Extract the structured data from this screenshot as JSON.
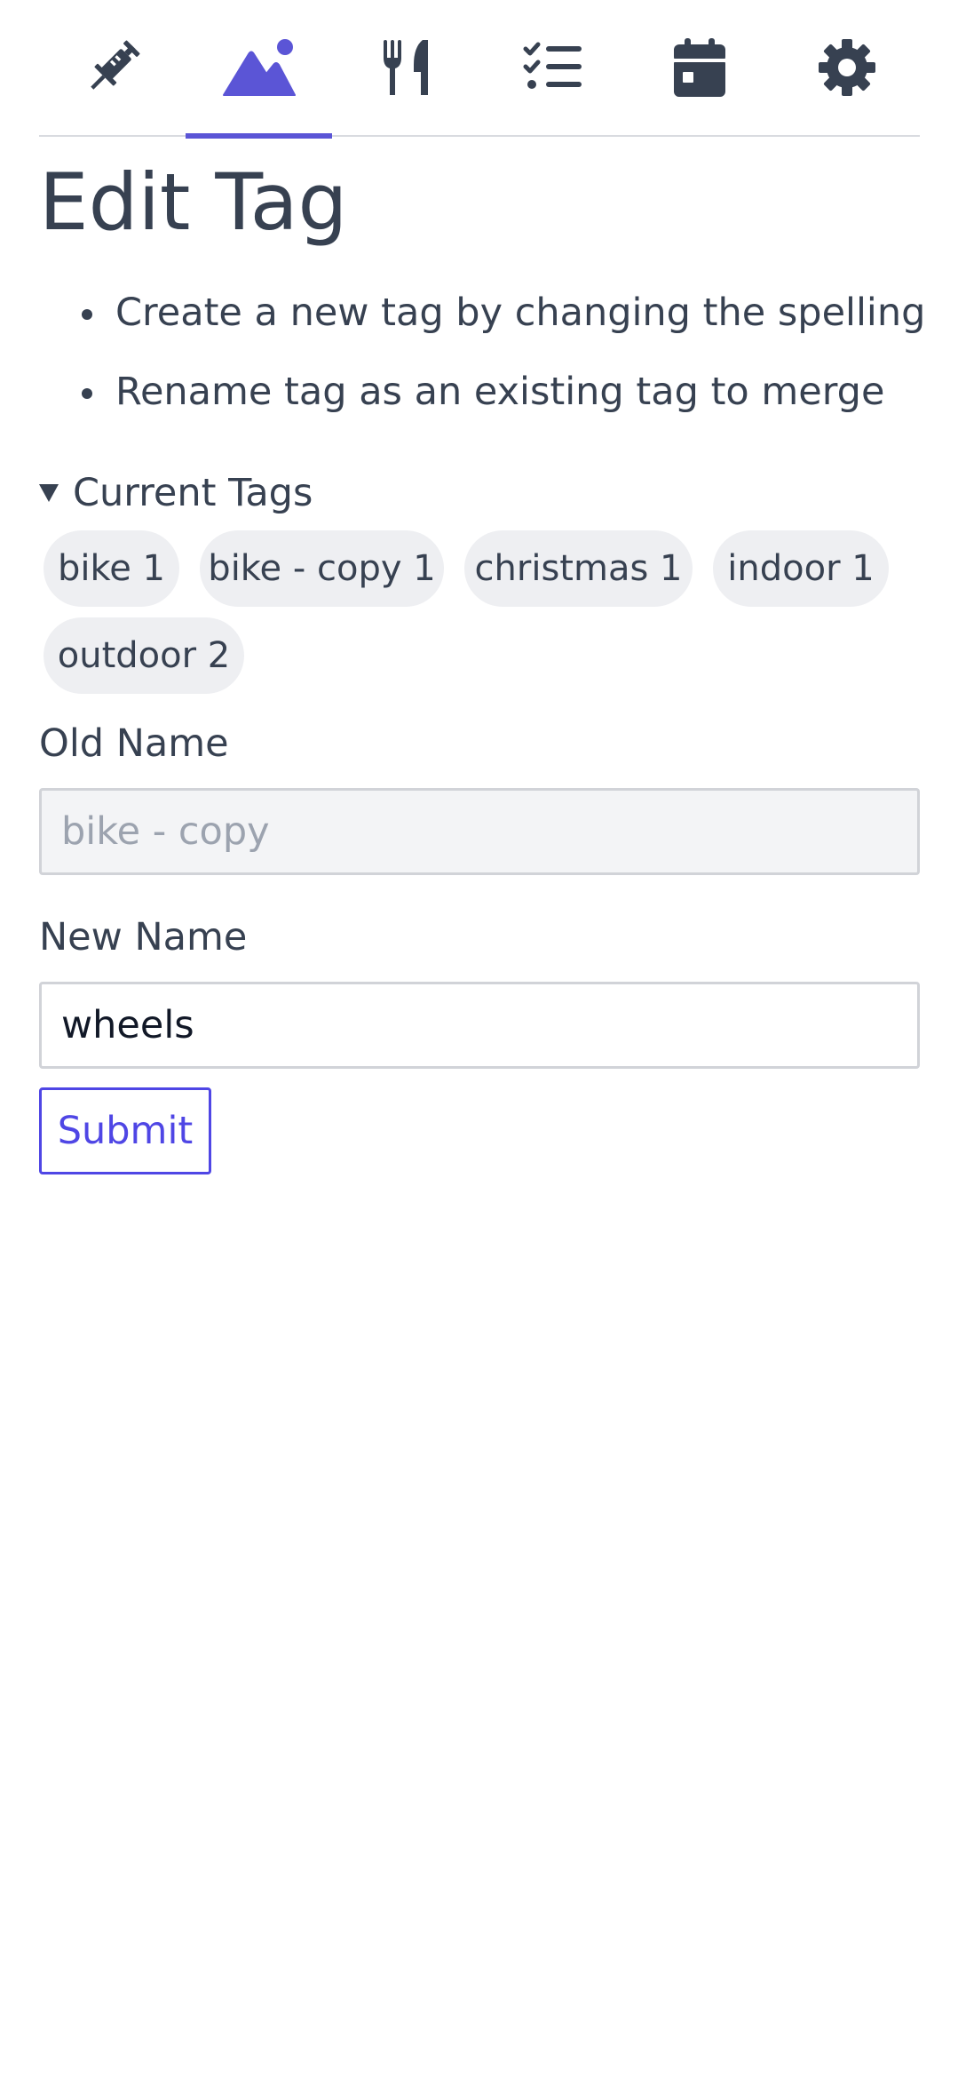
{
  "nav": {
    "tabs": [
      {
        "icon": "syringe-icon",
        "label": "",
        "active": false
      },
      {
        "icon": "mountain-icon",
        "label": "",
        "active": true
      },
      {
        "icon": "utensils-icon",
        "label": "",
        "active": false
      },
      {
        "icon": "checklist-icon",
        "label": "",
        "active": false
      },
      {
        "icon": "calendar-icon",
        "label": "",
        "active": false
      },
      {
        "icon": "gear-icon",
        "label": "",
        "active": false
      }
    ],
    "accent_color": "#5b55d6"
  },
  "page": {
    "title": "Edit Tag",
    "tips": [
      "Create a new tag by changing the spelling",
      "Rename tag as an existing tag to merge"
    ]
  },
  "current_tags": {
    "label": "Current Tags",
    "expanded": true,
    "tags": [
      "bike 1",
      "bike - copy 1",
      "christmas 1",
      "indoor 1",
      "outdoor 2"
    ]
  },
  "form": {
    "old_name_label": "Old Name",
    "old_name_value": "bike - copy",
    "new_name_label": "New Name",
    "new_name_value": "wheels",
    "submit_label": "Submit"
  },
  "colors": {
    "text": "#374151",
    "primary": "#4f46e5",
    "tag_bg": "#eeeff2"
  }
}
